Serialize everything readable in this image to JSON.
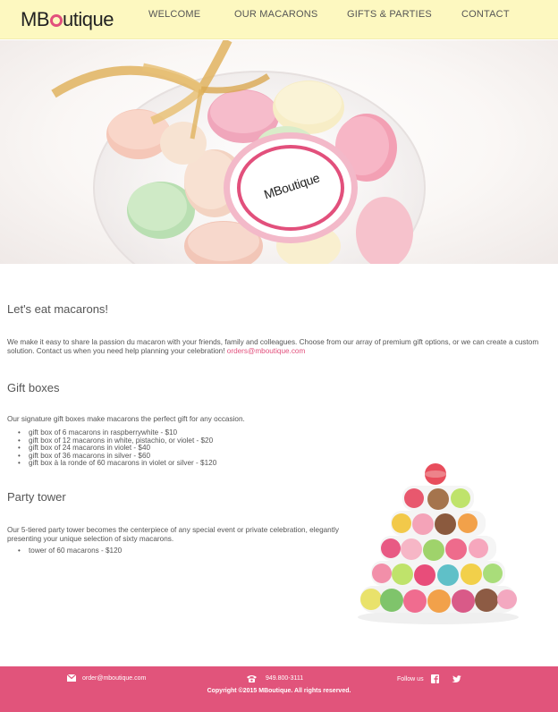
{
  "header": {
    "logo": {
      "pre": "MB",
      "post": "utique"
    },
    "nav": [
      "WELCOME",
      "OUR MACARONS",
      "GIFTS & PARTIES",
      "CONTACT"
    ]
  },
  "hero": {
    "badge_text": "MBoutique"
  },
  "intro": {
    "title": "Let's eat macarons!",
    "text": "We make it easy to share la passion du macaron with your friends, family and colleagues. Choose from our array of premium gift options, or we can create a custom solution. Contact us when you need help planning your celebration! ",
    "email": "orders@mboutique.com"
  },
  "gift_boxes": {
    "title": "Gift boxes",
    "text": "Our signature gift boxes make macarons the perfect gift for any occasion.",
    "items": [
      "gift box of 6 macarons in raspberrywhite - $10",
      "gift box of 12 macarons in white, pistachio, or violet - $20",
      "gift box of 24 macarons in violet - $40",
      "gift box of 36 macarons in silver - $60",
      "gift box à la ronde of 60 macarons in violet or silver - $120"
    ]
  },
  "party_tower": {
    "title": "Party tower",
    "text": "Our 5-tiered party tower becomes the centerpiece of any special event or private celebration, elegantly presenting your unique selection of sixty macarons.",
    "items": [
      "tower of 60 macarons - $120"
    ]
  },
  "footer": {
    "email": "order@mboutique.com",
    "phone": "949.800-3111",
    "follow": "Follow us",
    "copyright": "Copyright ©2015 MBoutique. All rights reserved.",
    "icons": [
      "envelope-icon",
      "phone-icon",
      "facebook-icon",
      "twitter-icon"
    ]
  },
  "colors": {
    "accent": "#e1547b",
    "header_bg": "#fdf8c0",
    "text": "#555555"
  }
}
